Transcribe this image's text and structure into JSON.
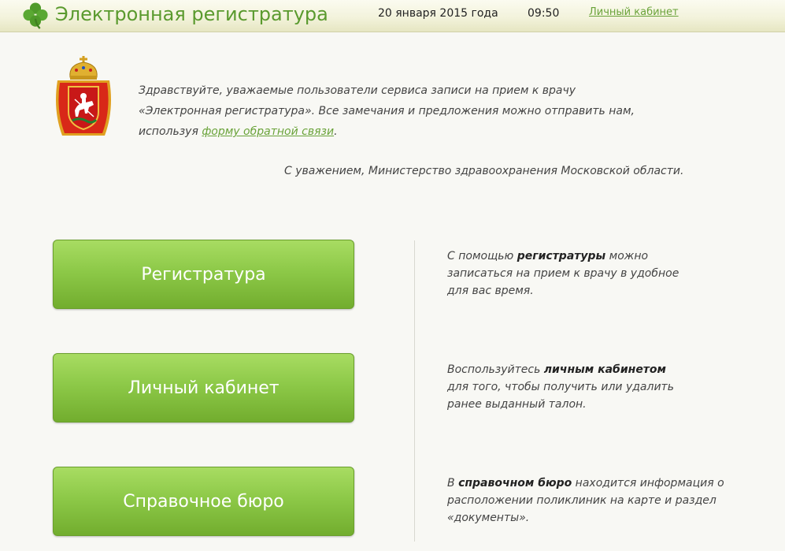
{
  "header": {
    "app_title": "Электронная регистратура",
    "date": "20 января 2015 года",
    "time": "09:50",
    "cabinet_link": "Личный кабинет"
  },
  "welcome": {
    "line1": "Здравствуйте, уважаемые пользователи сервиса записи на прием к врачу",
    "line2": "«Электронная регистратура». Все замечания и предложения можно отправить нам,",
    "line3_before": "используя ",
    "line3_link": "форму обратной связи",
    "line3_after": ".",
    "signature": "С уважением, Министерство здравоохранения Московской области."
  },
  "sections": {
    "registry": {
      "button_label": "Регистратура",
      "d1_before": "С помощью ",
      "d1_bold": "регистратуры",
      "d1_after": " можно",
      "d2": "записаться на прием к врачу в удобное",
      "d3": "для вас время."
    },
    "cabinet": {
      "button_label": "Личный кабинет",
      "d1_before": "Воспользуйтесь ",
      "d1_bold": "личным кабинетом",
      "d2": "для того, чтобы получить или удалить",
      "d3": "ранее выданный талон."
    },
    "bureau": {
      "button_label": "Справочное бюро",
      "d1_before": "В ",
      "d1_bold": "справочном бюро",
      "d1_after": " находится информация о",
      "d2": "расположении поликлиник на карте и раздел",
      "d3": "«документы»."
    }
  },
  "colors": {
    "accent_green": "#5a9a2e",
    "button_green": "#8dc948",
    "link_green": "#6aa33a"
  },
  "icons": {
    "logo": "clover-icon",
    "emblem": "moscow-region-coat-of-arms"
  }
}
